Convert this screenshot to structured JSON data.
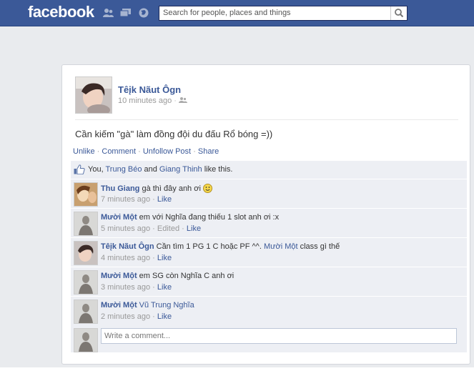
{
  "header": {
    "logo": "facebook",
    "search_placeholder": "Search for people, places and things"
  },
  "post": {
    "author": "Têįk Nãut Ôgn",
    "time": "10 minutes ago",
    "text": "Cần kiếm \"gà\" làm đồng đội du đấu Rổ bóng =))",
    "actions": {
      "unlike": "Unlike",
      "comment": "Comment",
      "unfollow": "Unfollow Post",
      "share": "Share"
    },
    "likes": {
      "you": "You, ",
      "name1": "Trung Béo",
      "and": " and ",
      "name2": "Giang Thinh",
      "suffix": " like this."
    }
  },
  "comments": [
    {
      "name": "Thu Giang",
      "text": "gà thì đây anh ơi",
      "time": "7 minutes ago",
      "edited": "",
      "like": "Like"
    },
    {
      "name": "Mười Một",
      "text": "em với Nghĩa đang thiếu 1 slot anh ơi :x",
      "time": "5 minutes ago",
      "edited": "Edited",
      "like": "Like"
    },
    {
      "name": "Têįk Nãut Ôgn",
      "text": "Cần tìm 1 PG 1 C hoặc PF ^^. ",
      "mention": "Mười Một",
      "text2": " class gì thế",
      "time": "4 minutes ago",
      "edited": "",
      "like": "Like"
    },
    {
      "name": "Mười Một",
      "text": "em SG còn Nghĩa C anh ơi",
      "time": "3 minutes ago",
      "edited": "",
      "like": "Like"
    },
    {
      "name": "Mười Một",
      "text": "",
      "mention": "Vũ Trung Nghĩa",
      "time": "2 minutes ago",
      "edited": "",
      "like": "Like"
    }
  ],
  "write_comment_placeholder": "Write a comment..."
}
